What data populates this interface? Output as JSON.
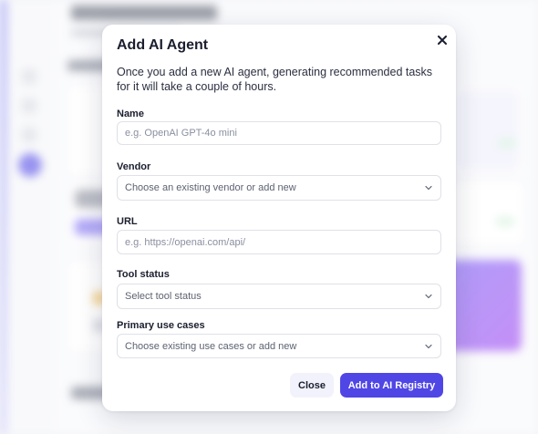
{
  "modal": {
    "title": "Add AI Agent",
    "description": "Once you add a new AI agent, generating recommended tasks for it will take a couple of hours.",
    "fields": {
      "name": {
        "label": "Name",
        "placeholder": "e.g. OpenAI GPT-4o mini"
      },
      "vendor": {
        "label": "Vendor",
        "placeholder": "Choose an existing vendor or add new"
      },
      "url": {
        "label": "URL",
        "placeholder": "e.g. https://openai.com/api/"
      },
      "tool_status": {
        "label": "Tool status",
        "placeholder": "Select tool status"
      },
      "use_cases": {
        "label": "Primary use cases",
        "placeholder": "Choose existing use cases or add new"
      }
    },
    "buttons": {
      "close": "Close",
      "submit": "Add to AI Registry"
    }
  },
  "colors": {
    "accent": "#4f46e5",
    "text": "#1b1e2e",
    "border": "#dfe1e8"
  },
  "icons": {
    "close": "close-icon",
    "dropdown": "chevron-down-icon"
  }
}
